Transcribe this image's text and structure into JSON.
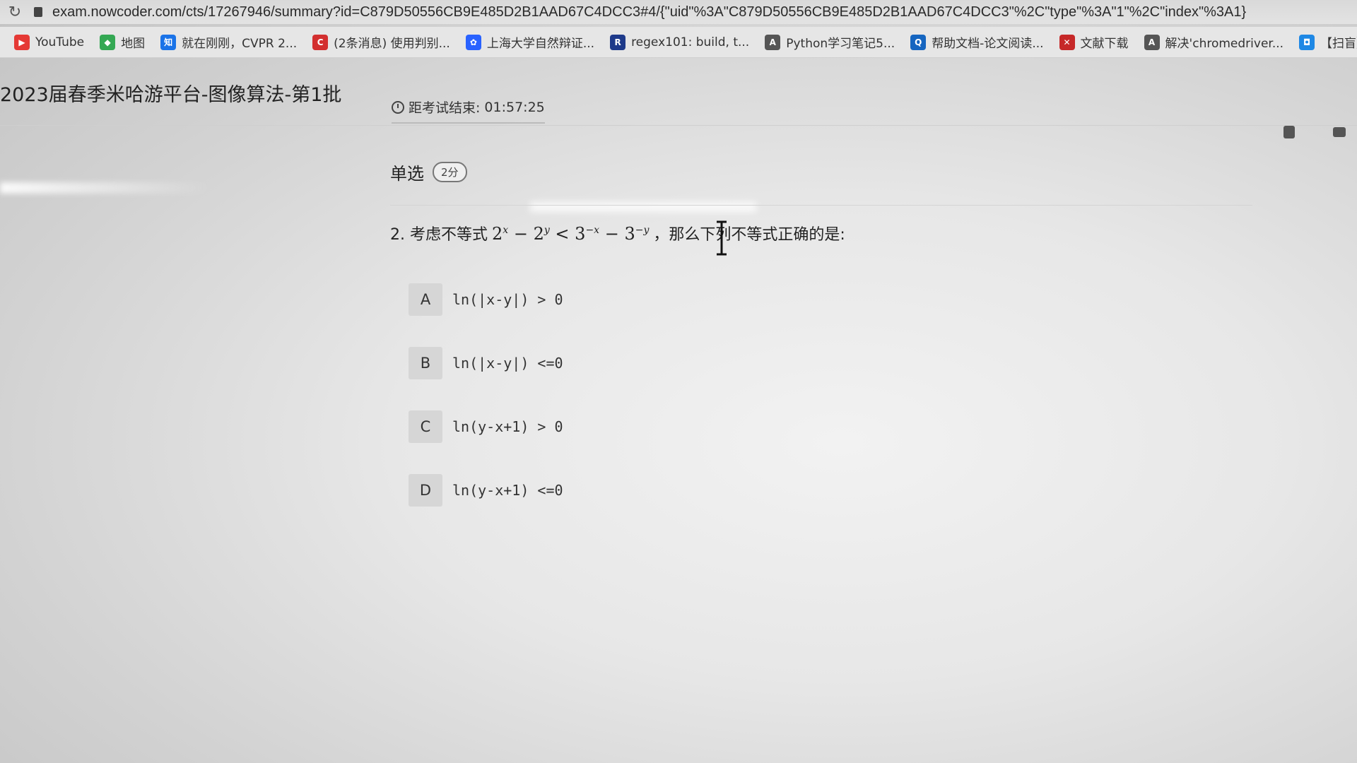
{
  "browser": {
    "url": "exam.nowcoder.com/cts/17267946/summary?id=C879D50556CB9E485D2B1AAD67C4DCC3#4/{\"uid\"%3A\"C879D50556CB9E485D2B1AAD67C4DCC3\"%2C\"type\"%3A\"1\"%2C\"index\"%3A1}",
    "bookmarks": [
      {
        "label": "YouTube",
        "icon": "youtube-icon",
        "color": "#e53935",
        "glyph": "▶"
      },
      {
        "label": "地图",
        "icon": "maps-icon",
        "color": "#34a853",
        "glyph": "◆"
      },
      {
        "label": "就在刚刚，CVPR 2...",
        "icon": "zhihu-icon",
        "color": "#1a73e8",
        "glyph": "知"
      },
      {
        "label": "(2条消息) 使用判别...",
        "icon": "csdn-icon",
        "color": "#d32f2f",
        "glyph": "C"
      },
      {
        "label": "上海大学自然辩证...",
        "icon": "baidu-icon",
        "color": "#2962ff",
        "glyph": "✿"
      },
      {
        "label": "regex101: build, t...",
        "icon": "regex-icon",
        "color": "#1e3a8a",
        "glyph": "R"
      },
      {
        "label": "Python学习笔记5...",
        "icon": "yuque-icon",
        "color": "#555555",
        "glyph": "A"
      },
      {
        "label": "帮助文档-论文阅读...",
        "icon": "help-doc-icon",
        "color": "#1565c0",
        "glyph": "Q"
      },
      {
        "label": "文献下载",
        "icon": "download-icon",
        "color": "#c62828",
        "glyph": "✕"
      },
      {
        "label": "解决'chromedriver...",
        "icon": "yuque-icon",
        "color": "#555555",
        "glyph": "A"
      },
      {
        "label": "【扫盲】Deep",
        "icon": "bilibili-icon",
        "color": "#1e88e5",
        "glyph": "◘"
      }
    ]
  },
  "header": {
    "exam_title": "2023届春季米哈游平台-图像算法-第1批",
    "timer_label": "距考试结束:",
    "timer_value": "01:57:25"
  },
  "question": {
    "type_label": "单选",
    "score": "2分",
    "prefix": "2. 考虑不等式",
    "inequality_lhs_base1": "2",
    "inequality_lhs_exp1": "x",
    "minus1": "−",
    "inequality_lhs_base2": "2",
    "inequality_lhs_exp2": "y",
    "lt": "<",
    "inequality_rhs_base1": "3",
    "inequality_rhs_exp1": "−x",
    "minus2": "−",
    "inequality_rhs_base2": "3",
    "inequality_rhs_exp2": "−y",
    "suffix": "，那么下列不等式正确的是:",
    "options": [
      {
        "key": "A",
        "text": "ln(|x-y|) > 0"
      },
      {
        "key": "B",
        "text": "ln(|x-y|) <=0"
      },
      {
        "key": "C",
        "text": "ln(y-x+1) > 0"
      },
      {
        "key": "D",
        "text": "ln(y-x+1) <=0"
      }
    ]
  }
}
